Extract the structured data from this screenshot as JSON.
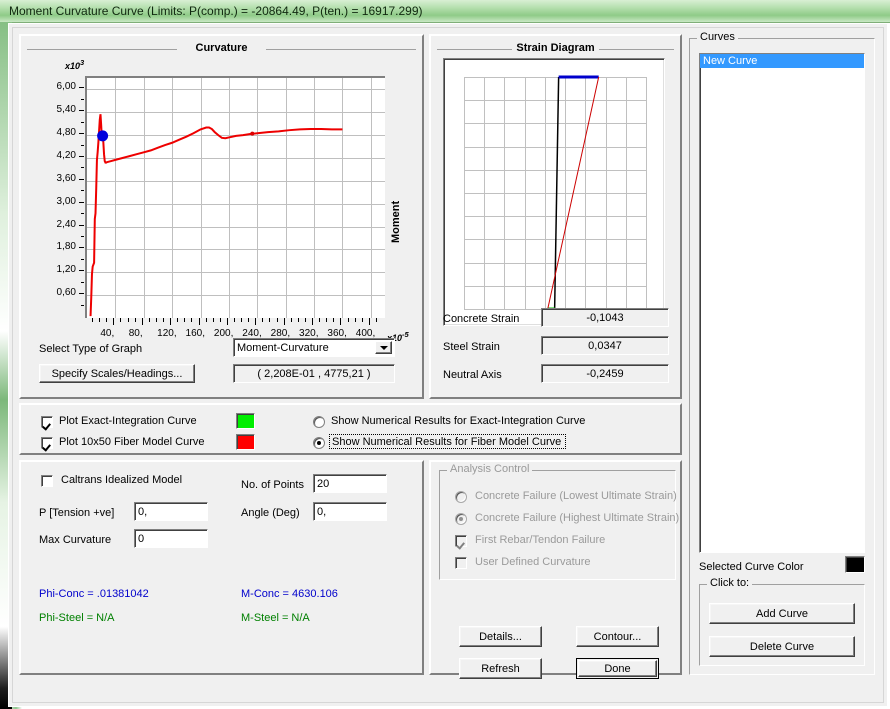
{
  "window": {
    "title": "Moment Curvature Curve (Limits:  P(comp.) = -20864.49, P(ten.) = 16917.299)"
  },
  "curvature_panel": {
    "title": "Curvature",
    "select_graph_label": "Select Type of Graph",
    "graph_type_value": "Moment-Curvature",
    "specify_scales_button": "Specify Scales/Headings...",
    "coordinate_readout": "( 2,208E-01 , 4775,21 )"
  },
  "strain_panel": {
    "title": "Strain Diagram",
    "rows": [
      {
        "label": "Concrete Strain",
        "value": "-0,1043"
      },
      {
        "label": "Steel Strain",
        "value": "0,0347"
      },
      {
        "label": "Neutral Axis",
        "value": "-0,2459"
      }
    ]
  },
  "plot_options": {
    "exact_integration_label": "Plot Exact-Integration Curve",
    "exact_integration_checked": true,
    "exact_integration_color": "#00ee00",
    "fiber_model_label": "Plot 10x50 Fiber Model Curve",
    "fiber_model_checked": true,
    "fiber_model_color": "#ff0000",
    "show_exact_label": "Show Numerical Results for Exact-Integration Curve",
    "show_exact_selected": false,
    "show_fiber_label": "Show Numerical Results for Fiber Model Curve",
    "show_fiber_selected": true
  },
  "parameters": {
    "caltrans_label": "Caltrans Idealized Model",
    "caltrans_checked": false,
    "p_tension_label": "P [Tension +ve]",
    "p_tension_value": "0,",
    "max_curvature_label": "Max Curvature",
    "max_curvature_value": "0",
    "no_of_points_label": "No. of Points",
    "no_of_points_value": "20",
    "angle_label": "Angle (Deg)",
    "angle_value": "0,",
    "phi_conc": "Phi-Conc = .01381042",
    "m_conc": "M-Conc = 4630.106",
    "phi_steel": "Phi-Steel = N/A",
    "m_steel": "M-Steel = N/A",
    "blue_color": "#0000cc",
    "green_color": "#008000"
  },
  "analysis_control": {
    "title": "Analysis Control",
    "options": [
      {
        "label": "Concrete Failure (Lowest Ultimate Strain)",
        "type": "radio",
        "selected": false
      },
      {
        "label": "Concrete Failure (Highest Ultimate Strain)",
        "type": "radio",
        "selected": true
      },
      {
        "label": "First Rebar/Tendon Failure",
        "type": "check",
        "selected": true
      },
      {
        "label": "User Defined Curvature",
        "type": "check",
        "selected": false
      }
    ]
  },
  "action_buttons": {
    "details": "Details...",
    "contour": "Contour...",
    "refresh": "Refresh",
    "done": "Done"
  },
  "curves_panel": {
    "title": "Curves",
    "items": [
      "New Curve"
    ],
    "selected_index": 0,
    "selected_color_label": "Selected Curve Color",
    "selected_color": "#000000",
    "click_to_title": "Click to:",
    "add_curve": "Add Curve",
    "delete_curve": "Delete Curve"
  },
  "chart_data": {
    "type": "line",
    "title": "Curvature",
    "xlabel": "",
    "ylabel": "Moment",
    "x_multiplier": "x10",
    "x_exponent": "-5",
    "y_multiplier": "x10",
    "y_exponent": "3",
    "xlim": [
      0,
      420
    ],
    "ylim": [
      0,
      6.3
    ],
    "xticks": [
      "40,",
      "80,",
      "120,",
      "160,",
      "200,",
      "240,",
      "280,",
      "320,",
      "360,",
      "400,"
    ],
    "xtick_values": [
      40,
      80,
      120,
      160,
      200,
      240,
      280,
      320,
      360,
      400
    ],
    "yticks": [
      "0,60",
      "1,20",
      "1,80",
      "2,40",
      "3,00",
      "3,60",
      "4,20",
      "4,80",
      "5,40",
      "6,00"
    ],
    "ytick_values": [
      0.6,
      1.2,
      1.8,
      2.4,
      3.0,
      3.6,
      4.2,
      4.8,
      5.4,
      6.0
    ],
    "grid": true,
    "legend": "none",
    "series": [
      {
        "name": "Fiber Model Curve",
        "color": "#ee0000",
        "x": [
          5,
          6,
          7,
          8,
          9,
          10,
          11,
          12,
          13,
          14,
          15,
          16,
          17,
          18,
          19,
          20,
          21,
          22,
          23,
          24,
          25,
          26,
          27,
          28,
          30,
          34,
          40,
          50,
          60,
          70,
          80,
          90,
          100,
          110,
          120,
          130,
          140,
          150,
          160,
          168,
          172,
          176,
          180,
          185,
          190,
          195,
          200,
          210,
          220,
          230,
          240,
          255,
          270,
          285,
          300,
          315,
          330,
          345,
          360
        ],
        "y": [
          0.05,
          0.55,
          1.15,
          1.35,
          1.4,
          1.45,
          2.6,
          2.75,
          3.4,
          4.15,
          4.35,
          4.6,
          4.9,
          5.2,
          5.35,
          5.05,
          4.7,
          4.8,
          4.62,
          4.3,
          4.12,
          4.08,
          4.08,
          4.09,
          4.1,
          4.12,
          4.15,
          4.2,
          4.25,
          4.3,
          4.35,
          4.4,
          4.47,
          4.54,
          4.6,
          4.68,
          4.76,
          4.85,
          4.95,
          5.0,
          5.0,
          4.96,
          4.88,
          4.8,
          4.73,
          4.72,
          4.74,
          4.78,
          4.8,
          4.83,
          4.85,
          4.88,
          4.9,
          4.93,
          4.95,
          4.96,
          4.96,
          4.95,
          4.95
        ]
      }
    ],
    "markers": [
      {
        "x": 22,
        "y": 4.78,
        "color": "#0000dd",
        "shape": "circle",
        "size": 11
      },
      {
        "x": 233,
        "y": 4.84,
        "color": "#dd0000",
        "shape": "circle",
        "size": 4
      }
    ]
  },
  "strain_chart": {
    "type": "diagram",
    "grid_cols": 9,
    "grid_rows": 10,
    "section_line_color": "#000000",
    "top_cap_color": "#0000cc",
    "bottom_cap_color": "#00cc00",
    "strain_line_color": "#cc0000",
    "section_x_frac": 0.52,
    "strain_top_frac": 0.74,
    "strain_bottom_frac": 0.46
  }
}
